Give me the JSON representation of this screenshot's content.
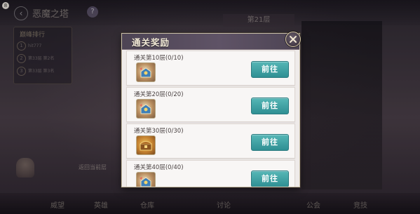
{
  "background": {
    "corner_badge": "8",
    "back_glyph": "‹",
    "page_title": "恶魔之塔",
    "help_glyph": "?",
    "rank_panel_title": "巅峰排行",
    "rank_rows": [
      {
        "rank": "1",
        "text": "hit777"
      },
      {
        "rank": "2",
        "text": "第33层 第2名"
      },
      {
        "rank": "3",
        "text": "第33层 第3名"
      }
    ],
    "floor_label": "第21层",
    "floor_button": "返回当前层",
    "bottom_nav": [
      "威望",
      "英雄",
      "仓库",
      "讨论",
      "公会",
      "竞技"
    ]
  },
  "modal": {
    "title": "通关奖励",
    "items": [
      {
        "title": "通关第10层(0/10)",
        "button": "前往",
        "reward_style": "blue"
      },
      {
        "title": "通关第20层(0/20)",
        "button": "前往",
        "reward_style": "blue"
      },
      {
        "title": "通关第30层(0/30)",
        "button": "前往",
        "reward_style": "gold"
      },
      {
        "title": "通关第40层(0/40)",
        "button": "前往",
        "reward_style": "blue"
      }
    ]
  },
  "colors": {
    "accent_button": "#3aa0a2",
    "header_bar": "#564b5d",
    "panel_bg": "#efebea"
  }
}
